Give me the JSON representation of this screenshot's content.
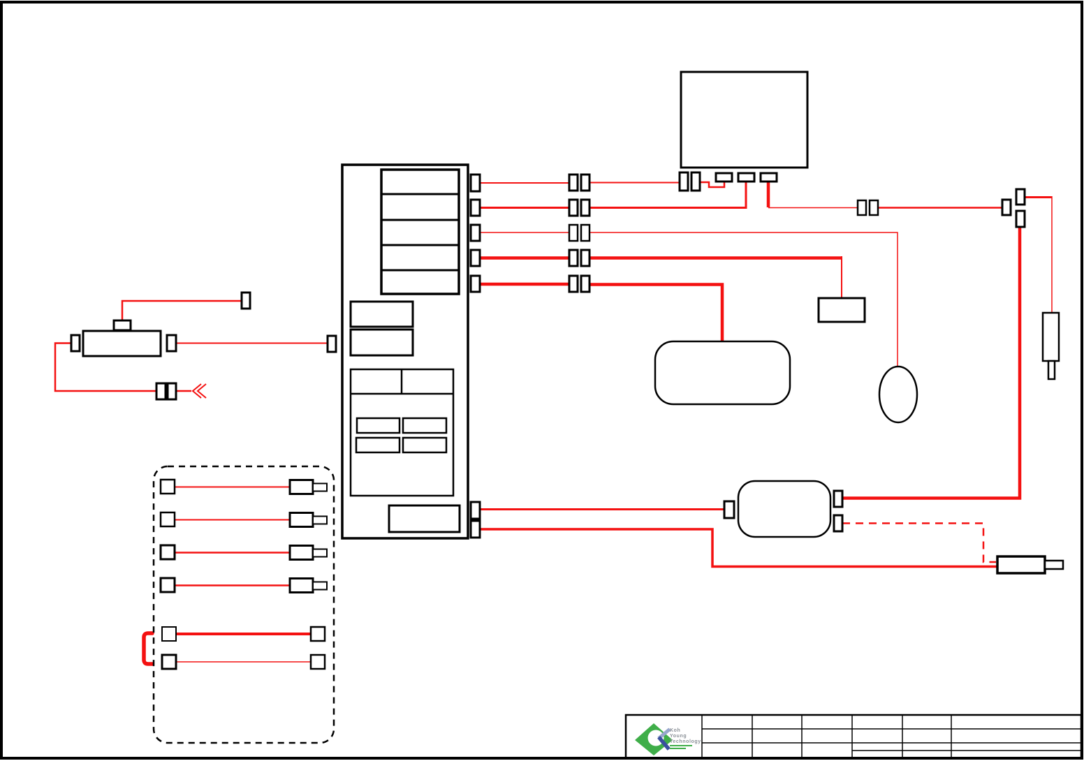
{
  "colors": {
    "background": "#ffffff",
    "wire": "#f41111",
    "outline": "#000000",
    "title_line": "#000000",
    "logo_green": "#3fae49",
    "logo_blue_dark": "#3a4f9f",
    "logo_blue_light": "#98a7cd",
    "logo_text": "#8a9097"
  },
  "title_block": {
    "company_lines": [
      "Koh",
      "Young",
      "Technology"
    ]
  },
  "icons": {
    "logo": "koh-young-logo",
    "ground_chevron": "double-chevron-left-icon"
  }
}
